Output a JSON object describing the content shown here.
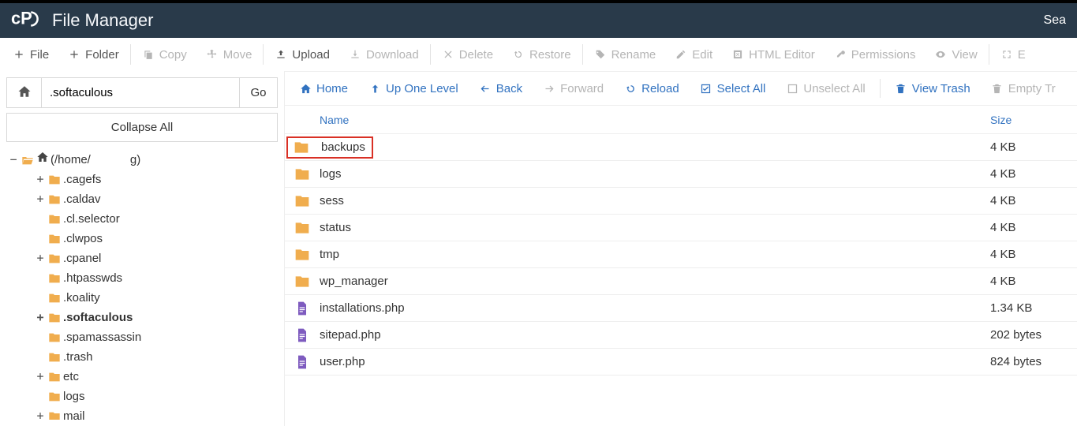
{
  "header": {
    "title": "File Manager",
    "search_label": "Sea"
  },
  "toolbar": {
    "file": "File",
    "folder": "Folder",
    "copy": "Copy",
    "move": "Move",
    "upload": "Upload",
    "download": "Download",
    "delete": "Delete",
    "restore": "Restore",
    "rename": "Rename",
    "edit": "Edit",
    "html_editor": "HTML Editor",
    "permissions": "Permissions",
    "view": "View",
    "extra": "E"
  },
  "path_input": ".softaculous",
  "go_label": "Go",
  "collapse_label": "Collapse All",
  "tree": {
    "root_label": "(/home/            g)",
    "items": [
      {
        "label": ".cagefs",
        "expandable": true
      },
      {
        "label": ".caldav",
        "expandable": true
      },
      {
        "label": ".cl.selector",
        "expandable": false
      },
      {
        "label": ".clwpos",
        "expandable": false
      },
      {
        "label": ".cpanel",
        "expandable": true
      },
      {
        "label": ".htpasswds",
        "expandable": false
      },
      {
        "label": ".koality",
        "expandable": false
      },
      {
        "label": ".softaculous",
        "expandable": true,
        "bold": true
      },
      {
        "label": ".spamassassin",
        "expandable": false
      },
      {
        "label": ".trash",
        "expandable": false
      },
      {
        "label": "etc",
        "expandable": true
      },
      {
        "label": "logs",
        "expandable": false
      },
      {
        "label": "mail",
        "expandable": true
      }
    ]
  },
  "actions": {
    "home": "Home",
    "up": "Up One Level",
    "back": "Back",
    "forward": "Forward",
    "reload": "Reload",
    "select_all": "Select All",
    "unselect_all": "Unselect All",
    "view_trash": "View Trash",
    "empty_trash": "Empty Tr"
  },
  "table": {
    "columns": {
      "name": "Name",
      "size": "Size"
    },
    "rows": [
      {
        "type": "folder",
        "name": "backups",
        "size": "4 KB",
        "highlight": true
      },
      {
        "type": "folder",
        "name": "logs",
        "size": "4 KB"
      },
      {
        "type": "folder",
        "name": "sess",
        "size": "4 KB"
      },
      {
        "type": "folder",
        "name": "status",
        "size": "4 KB"
      },
      {
        "type": "folder",
        "name": "tmp",
        "size": "4 KB"
      },
      {
        "type": "folder",
        "name": "wp_manager",
        "size": "4 KB"
      },
      {
        "type": "file",
        "name": "installations.php",
        "size": "1.34 KB"
      },
      {
        "type": "file",
        "name": "sitepad.php",
        "size": "202 bytes"
      },
      {
        "type": "file",
        "name": "user.php",
        "size": "824 bytes"
      }
    ]
  }
}
